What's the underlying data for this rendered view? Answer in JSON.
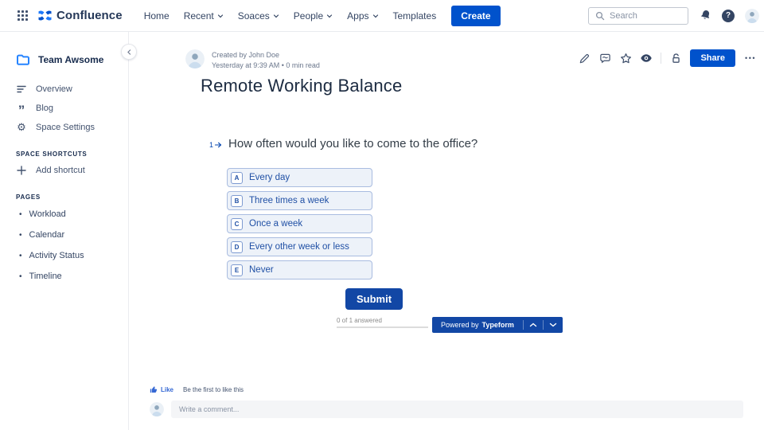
{
  "topnav": {
    "brand": "Confluence",
    "items": [
      {
        "label": "Home",
        "chevron": false
      },
      {
        "label": "Recent",
        "chevron": true
      },
      {
        "label": "Soaces",
        "chevron": true
      },
      {
        "label": "People",
        "chevron": true
      },
      {
        "label": "Apps",
        "chevron": true
      },
      {
        "label": "Templates",
        "chevron": false
      }
    ],
    "create_label": "Create",
    "search_placeholder": "Search"
  },
  "sidebar": {
    "space_name": "Team Awsome",
    "items": [
      {
        "label": "Overview",
        "icon": "overview-icon"
      },
      {
        "label": "Blog",
        "icon": "quote-icon"
      },
      {
        "label": "Space Settings",
        "icon": "gear-icon"
      }
    ],
    "shortcuts_header": "SPACE SHORTCUTS",
    "add_shortcut": "Add shortcut",
    "pages_header": "PAGES",
    "pages": [
      "Workload",
      "Calendar",
      "Activity Status",
      "Timeline"
    ]
  },
  "page": {
    "byline_author": "Created by John Doe",
    "byline_meta": "Yesterday at 9:39 AM  •  0 min read",
    "toolbar_icons": [
      "edit-icon",
      "comment-icon",
      "star-icon",
      "watch-icon"
    ],
    "share_label": "Share",
    "title": "Remote Working Balance"
  },
  "form": {
    "question_number": "1",
    "question": "How often would you like to come to the office?",
    "options": [
      {
        "key": "A",
        "label": "Every day"
      },
      {
        "key": "B",
        "label": "Three times a week"
      },
      {
        "key": "C",
        "label": "Once a week"
      },
      {
        "key": "D",
        "label": "Every other week or less"
      },
      {
        "key": "E",
        "label": "Never"
      }
    ],
    "submit_label": "Submit",
    "progress_text": "0 of 1 answered",
    "powered_prefix": "Powered by",
    "powered_brand": "Typeform"
  },
  "footer": {
    "like_label": "Like",
    "like_hint": "Be the first to like this",
    "comment_placeholder": "Write a comment..."
  },
  "colors": {
    "atlassian_blue": "#0052CC",
    "typeform_blue": "#1247A5",
    "option_text_blue": "#2050A5",
    "nav_text": "#344563",
    "muted_text": "#6B778C"
  }
}
